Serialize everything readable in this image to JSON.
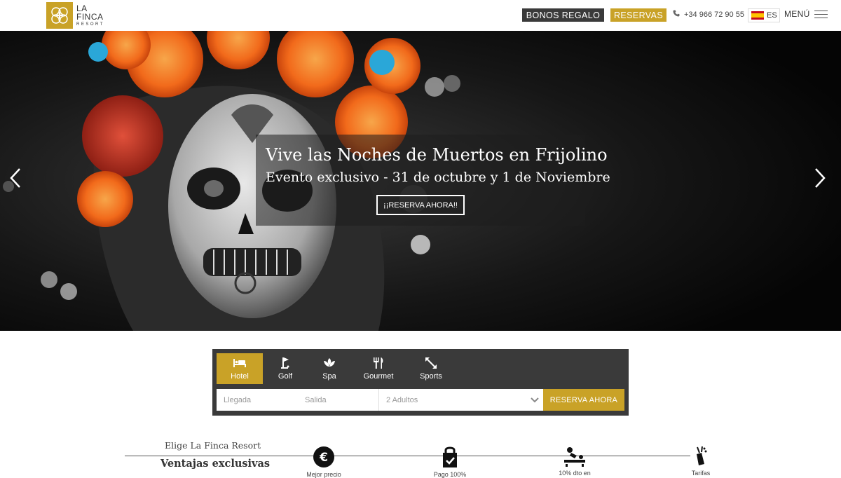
{
  "brand": {
    "line1": "LA",
    "line2": "FINCA",
    "line3": "RESORT",
    "accent": "#c9a227",
    "dark": "#3a3a3a"
  },
  "header": {
    "bonos_label": "BONOS REGALO",
    "reservas_label": "RESERVAS",
    "phone": "+34 966 72 90 55",
    "lang": "ES",
    "menu_label": "MENÚ"
  },
  "hero": {
    "title": "Vive las Noches de Muertos en Frijolino",
    "subtitle": "Evento exclusivo - 31 de octubre y 1 de Noviembre",
    "cta": "¡¡RESERVA AHORA!!",
    "prev_icon": "chevron-left-icon",
    "next_icon": "chevron-right-icon"
  },
  "booking": {
    "tabs": [
      {
        "label": "Hotel",
        "icon": "bed-icon"
      },
      {
        "label": "Golf",
        "icon": "golf-flag-icon"
      },
      {
        "label": "Spa",
        "icon": "lotus-icon"
      },
      {
        "label": "Gourmet",
        "icon": "cutlery-icon"
      },
      {
        "label": "Sports",
        "icon": "arrows-icon"
      }
    ],
    "arrival_placeholder": "Llegada",
    "departure_placeholder": "Salida",
    "guests_value": "2 Adultos",
    "submit_label": "RESERVA AHORA"
  },
  "benefits": {
    "heading": "Elige La Finca Resort",
    "subheading": "Ventajas exclusivas",
    "items": [
      {
        "label": "Mejor precio",
        "icon": "euro-icon"
      },
      {
        "label": "Pago 100%",
        "icon": "secure-lock-icon"
      },
      {
        "label": "10% dto en",
        "icon": "massage-icon"
      },
      {
        "label": "Tarifas",
        "icon": "golf-bag-icon"
      }
    ]
  }
}
